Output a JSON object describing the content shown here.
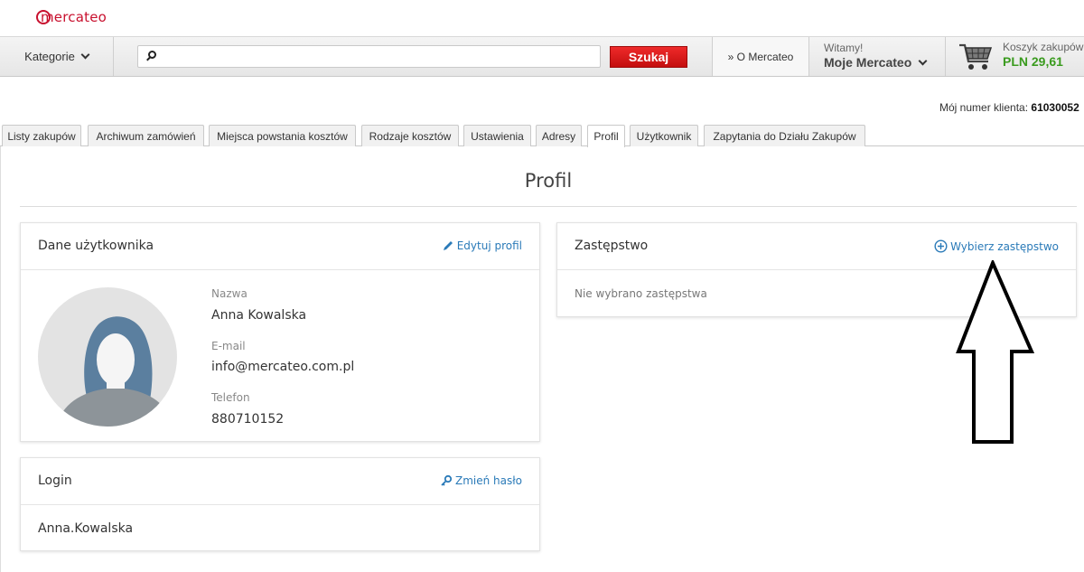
{
  "brand": {
    "logo_text": "mercateo",
    "accent": "#c8102e"
  },
  "nav": {
    "categories_label": "Kategorie",
    "search": {
      "value": "",
      "placeholder": ""
    },
    "search_button": "Szukaj",
    "about_label": "» O Mercateo",
    "welcome_small": "Witamy!",
    "account_label": "Moje Mercateo",
    "cart_label": "Koszyk zakupów",
    "cart_total": "PLN 29,61"
  },
  "client": {
    "label": "Mój numer klienta:",
    "number": "61030052"
  },
  "tabs": [
    {
      "label": "Listy zakupów"
    },
    {
      "label": "Archiwum zamówień"
    },
    {
      "label": "Miejsca powstania kosztów"
    },
    {
      "label": "Rodzaje kosztów"
    },
    {
      "label": "Ustawienia"
    },
    {
      "label": "Adresy"
    },
    {
      "label": "Profil",
      "active": true
    },
    {
      "label": "Użytkownik"
    },
    {
      "label": "Zapytania do Działu Zakupów"
    }
  ],
  "page": {
    "title": "Profil"
  },
  "user_card": {
    "title": "Dane użytkownika",
    "edit_link": "Edytuj profil",
    "name_label": "Nazwa",
    "name_value": "Anna Kowalska",
    "email_label": "E-mail",
    "email_value": "info@mercateo.com.pl",
    "phone_label": "Telefon",
    "phone_value": "880710152"
  },
  "login_card": {
    "title": "Login",
    "change_password_link": "Zmień hasło",
    "login_value": "Anna.Kowalska"
  },
  "substitute_card": {
    "title": "Zastępstwo",
    "choose_link": "Wybierz zastępstwo",
    "empty_text": "Nie wybrano zastępstwa"
  },
  "colors": {
    "link": "#2a7ab8",
    "price": "#3a9b1e",
    "button": "#d91616"
  },
  "icons": [
    "search-icon",
    "chevron-down-icon",
    "cart-icon",
    "pencil-icon",
    "plus-circle-icon",
    "key-icon",
    "avatar-icon",
    "arrow-up-annotation"
  ]
}
